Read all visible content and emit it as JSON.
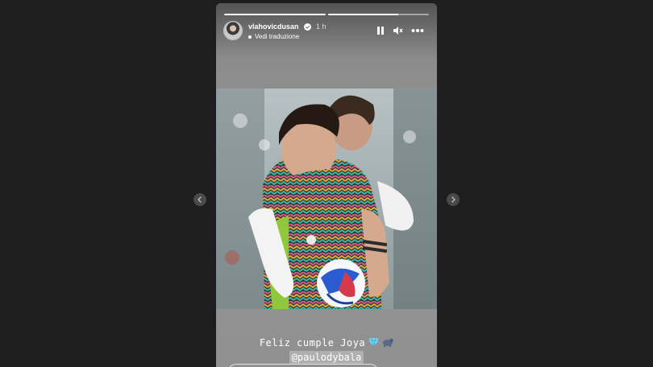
{
  "story": {
    "username": "vlahovicdusan",
    "verified_icon": "verified-badge-icon",
    "time_ago": "1 h",
    "translate_label": "Vedi traduzione",
    "progress_segments": [
      {
        "fill": 1.0
      },
      {
        "fill": 0.7
      }
    ],
    "controls": {
      "pause_icon": "pause-icon",
      "mute_icon": "speaker-muted-icon",
      "more_icon": "more-options-icon"
    },
    "photo_description_icon": "story-photo",
    "caption": {
      "line1": "Feliz cumple Joya",
      "emojis": [
        "gem-icon",
        "goat-icon"
      ],
      "mention": "@paulodybala"
    }
  },
  "navigation": {
    "prev_icon": "chevron-left-icon",
    "next_icon": "chevron-right-icon"
  },
  "colors": {
    "viewer_background": "#1e1e1e",
    "story_background": "#8d8d8d",
    "accent_white": "#ffffff"
  }
}
